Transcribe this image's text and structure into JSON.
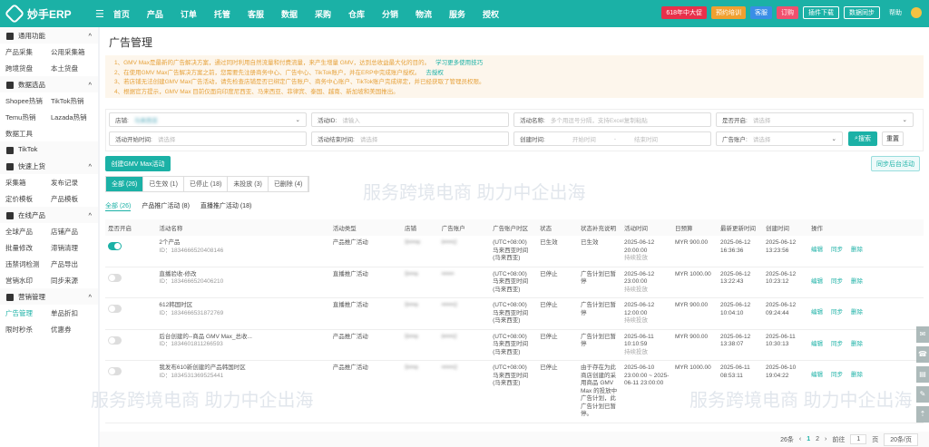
{
  "topbar": {
    "brand": "妙手ERP",
    "nav": [
      "首页",
      "产品",
      "订单",
      "托管",
      "客服",
      "数据",
      "采购",
      "仓库",
      "分销",
      "物流",
      "服务",
      "授权"
    ],
    "buttons": [
      "618年中大促",
      "预约培训",
      "客服",
      "订购",
      "插件下载",
      "数据同步",
      "帮助"
    ]
  },
  "sidebar": {
    "groups": [
      {
        "title": "通用功能",
        "items": [
          "产品采集",
          "公用采集箱",
          "跨境货盘",
          "本土货盘"
        ]
      },
      {
        "title": "数据选品",
        "items": [
          "Shopee热销",
          "TikTok热销",
          "Temu热销",
          "Lazada热销",
          "数据工具"
        ]
      },
      {
        "title": "TikTok",
        "items": []
      },
      {
        "title": "快速上货",
        "items": [
          "采集箱",
          "发布记录",
          "定价模板",
          "产品模板"
        ]
      },
      {
        "title": "在线产品",
        "items": [
          "全球产品",
          "店铺产品",
          "批量修改",
          "滞销清理",
          "违禁词检测",
          "产品导出",
          "営销水印",
          "同步来源"
        ]
      },
      {
        "title": "营销管理",
        "items": [
          "广告管理",
          "单品折扣",
          "限时秒杀",
          "优惠券"
        ]
      }
    ],
    "active": "广告管理"
  },
  "page": {
    "title": "广告管理"
  },
  "notice": {
    "lines": [
      "1、GMV Max是最新的广告解决方案，通过同时利用自然流量和付费流量，来产生增量 GMV，达到总收益最大化的目的。",
      "2、在使用GMV Max广告解决方案之前，您需要先注册商务中心、广告中心、TikTok账户，并在ERP中完成账户授权。",
      "3、若店铺无法创建GMV Max广告活动，请先检查店铺是否已绑定广告账户、商务中心账户、TikTok账户完成绑定，并已经获取了管理员权限。",
      "4、根据官方提示，GMV Max 目前仅面向印度尼西亚、马来西亚、菲律宾、泰国、越南、新加坡和美国推出。"
    ],
    "links": [
      "学习更多使用技巧",
      "去授权"
    ]
  },
  "filters": {
    "store_label": "店铺:",
    "store_value": "马来西亚",
    "id_label": "活动ID:",
    "id_ph": "请输入",
    "name_label": "活动名称:",
    "name_ph": "多个用逗号分隔，支持Excel复制粘贴",
    "open_label": "是否开启:",
    "open_ph": "请选择",
    "start_label": "活动开始时间:",
    "start_ph": "请选择",
    "end_label": "活动结束时间:",
    "end_ph": "请选择",
    "created_label": "创建时间:",
    "created_from": "开始时间",
    "created_sep": "-",
    "created_to": "结束时间",
    "account_label": "广告账户:",
    "account_ph": "请选择",
    "search": "搜索",
    "reset": "重置"
  },
  "actions": {
    "create": "创建GMV Max活动",
    "sync": "同步后台活动"
  },
  "tabs": [
    "全部 (26)",
    "已生效 (1)",
    "已停止 (18)",
    "未投放 (3)",
    "已删除 (4)"
  ],
  "subtabs": [
    "全部 (26)",
    "产品推广活动 (8)",
    "直播推广活动 (18)"
  ],
  "table": {
    "headers": [
      "是否开启",
      "活动名称",
      "活动类型",
      "店铺",
      "广告账户",
      "广告账户时区",
      "状态",
      "状态补充说明",
      "活动时间",
      "日预算",
      "最新更新时间",
      "创建时间",
      "操作"
    ],
    "ops": [
      "编辑",
      "同步",
      "删除"
    ],
    "rows": [
      {
        "on": true,
        "name": "2个产品",
        "id": "ID：1834666520408146",
        "type": "产品推广活动",
        "store": "S••••e",
        "account": "t•••••2",
        "tz": "(UTC+08:00) 马来西亚时间 (马来西亚)",
        "status": "已生效",
        "note": "已生效",
        "time": "2025-06-12 20:00:00",
        "time2": "持续投放",
        "budget": "MYR 900.00",
        "updated": "2025-06-12 16:36:36",
        "created": "2025-06-12 13:23:56"
      },
      {
        "on": false,
        "name": "直播验收-修改",
        "id": "ID：1834666520406210",
        "type": "直播推广活动",
        "store": "S•••e",
        "account": "••••••",
        "tz": "(UTC+08:00) 马来西亚时间 (马来西亚)",
        "status": "已停止",
        "note": "广告计划已暂停",
        "time": "2025-06-12 23:00:00",
        "time2": "持续投放",
        "budget": "MYR 1000.00",
        "updated": "2025-06-12 13:22:43",
        "created": "2025-06-12 10:23:12"
      },
      {
        "on": false,
        "name": "612韩国时区",
        "id": "ID：1834666531872769",
        "type": "直播推广活动",
        "store": "S•••e",
        "account": "••••••2",
        "tz": "(UTC+08:00) 马来西亚时间 (马来西亚)",
        "status": "已停止",
        "note": "广告计划已暂停",
        "time": "2025-06-12 12:00:00",
        "time2": "持续投放",
        "budget": "MYR 900.00",
        "updated": "2025-06-12 10:04:10",
        "created": "2025-06-12 09:24:44"
      },
      {
        "on": false,
        "name": "后台创建的--商品 GMV Max_总收...",
        "id": "ID：1834601811266593",
        "type": "产品推广活动",
        "store": "S•••e",
        "account": "t•••••2",
        "tz": "(UTC+08:00) 马来西亚时间 (马来西亚)",
        "status": "已停止",
        "note": "广告计划已暂停",
        "time": "2025-06-11 10:10:59",
        "time2": "持续投放",
        "budget": "MYR 900.00",
        "updated": "2025-06-12 13:38:07",
        "created": "2025-06-11 10:30:13"
      },
      {
        "on": false,
        "name": "我发布610新创建的产品韩国时区",
        "id": "ID：1834531369525441",
        "type": "产品推广活动",
        "store": "S•••e",
        "account": "••••••2",
        "tz": "(UTC+08:00) 马来西亚时间 (马来西亚)",
        "status": "已停止",
        "note": "由于存在为此商店创建的采用商品 GMV Max 的投放中广告计划，此广告计划已暂停。",
        "time": "2025-06-10 23:00:00 ~ 2025-06-11 23:00:00",
        "time2": "",
        "budget": "MYR 1000.00",
        "updated": "2025-06-11 08:53:11",
        "created": "2025-06-10 19:04:22"
      }
    ]
  },
  "pagination": {
    "total": "26条",
    "pages": [
      "1",
      "2"
    ],
    "goto": "前往",
    "page_input": "1",
    "page_unit": "页",
    "size": "20条/页"
  },
  "watermark": {
    "text": "服务跨境电商 助力中企出海"
  },
  "colors": {
    "accent": "#1bb1a6",
    "notice": "#e6a23c"
  }
}
